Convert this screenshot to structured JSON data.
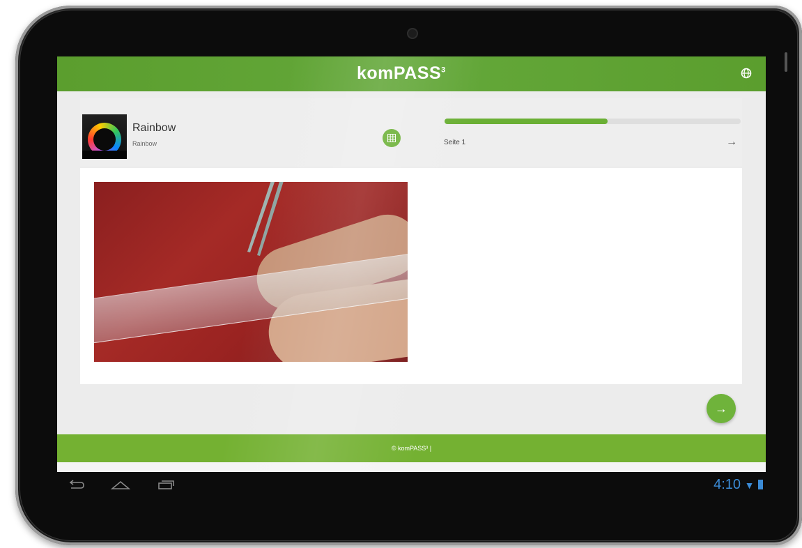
{
  "app": {
    "brand": "komPASS",
    "brand_sup": "3"
  },
  "module": {
    "title": "Rainbow",
    "subtitle": "Rainbow"
  },
  "progress": {
    "fraction": 0.55,
    "page_label": "Seite 1"
  },
  "footer": {
    "text": "© komPASS³ |"
  },
  "statusbar": {
    "time": "4:10"
  },
  "colors": {
    "accent": "#6aaf34",
    "header": "#5b9e2e",
    "footer": "#74b132"
  },
  "icons": {
    "globe": "globe-icon",
    "grid": "grid-icon",
    "arrow": "arrow-right-icon",
    "back": "back-icon",
    "home": "home-icon",
    "recents": "recents-icon"
  }
}
